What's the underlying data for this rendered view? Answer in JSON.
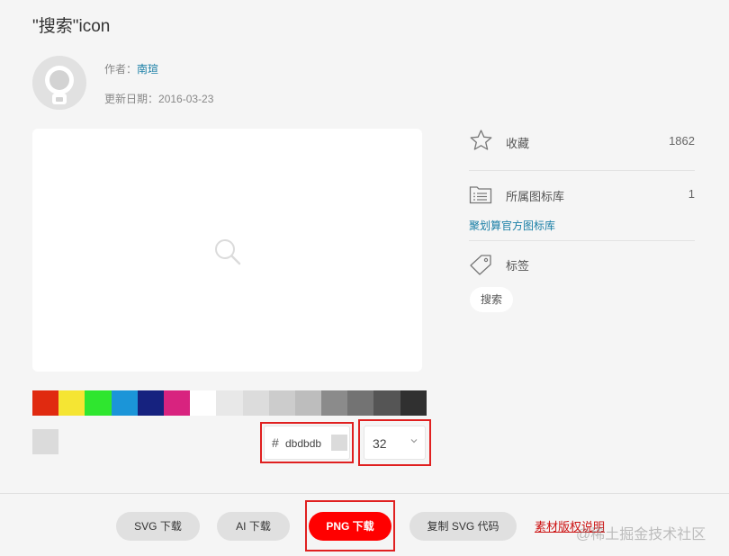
{
  "header": {
    "title": "\"搜索\"icon",
    "author_label": "作者：",
    "author_name": "南瑄",
    "date_label": "更新日期：",
    "date_value": "2016-03-23"
  },
  "palette": {
    "colors": [
      "#e02a10",
      "#f5e533",
      "#2fe62f",
      "#1b95d8",
      "#16227f",
      "#d8237f",
      "#ffffff",
      "#e8e8e8",
      "#dcdcdc",
      "#cccccc",
      "#bdbdbd",
      "#8b8b8b",
      "#737373",
      "#555555",
      "#303030"
    ]
  },
  "controls": {
    "hash": "#",
    "hex_value": "dbdbdb",
    "selected_color": "#dbdbdb",
    "size_value": "32"
  },
  "sidebar": {
    "favorites_label": "收藏",
    "favorites_count": "1862",
    "library_label": "所属图标库",
    "library_count": "1",
    "library_link": "聚划算官方图标库",
    "tags_label": "标签",
    "tags": [
      "搜索"
    ]
  },
  "actions": {
    "svg_download": "SVG 下载",
    "ai_download": "AI 下载",
    "png_download": "PNG 下载",
    "copy_svg": "复制 SVG 代码",
    "license": "素材版权说明"
  },
  "watermark": "@稀土掘金技术社区",
  "colors": {
    "accent_red": "#ff0000",
    "link_blue": "#1a7fa6",
    "highlight_border": "#e02020"
  }
}
